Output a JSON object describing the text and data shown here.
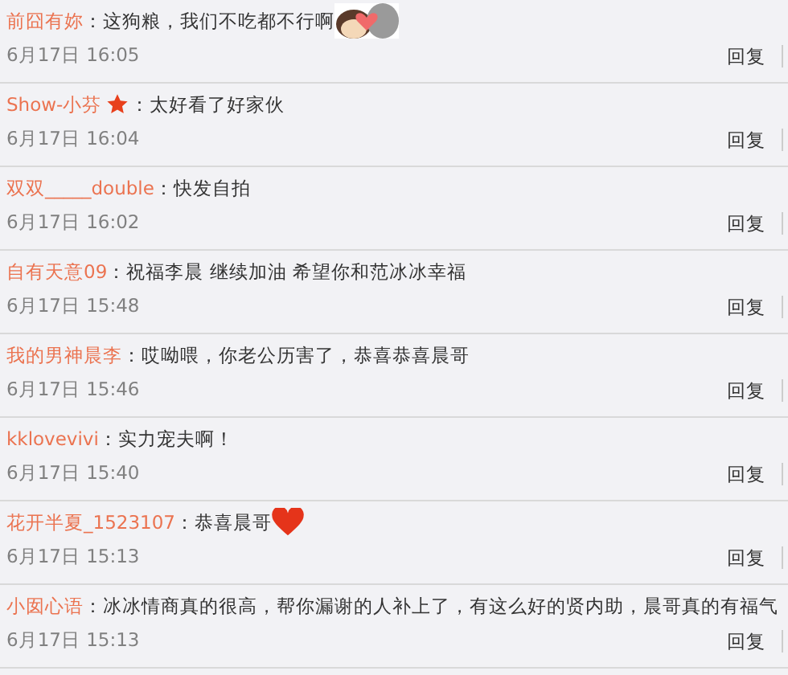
{
  "comments": [
    {
      "kind": "sticker",
      "user": "前囧有妳",
      "text": "：这狗粮，我们不吃都不行啊",
      "time": "6月17日 16:05",
      "reply": "回复"
    },
    {
      "kind": "badged",
      "user": "Show-小芬",
      "text": "：太好看了好家伙",
      "time": "6月17日 16:04",
      "reply": "回复"
    },
    {
      "kind": "plain",
      "user": "双双_____double",
      "text": "：快发自拍",
      "time": "6月17日 16:02",
      "reply": "回复"
    },
    {
      "kind": "plain",
      "user": "自有天意09",
      "text": "：祝福李晨 继续加油 希望你和范冰冰幸福",
      "time": "6月17日 15:48",
      "reply": "回复"
    },
    {
      "kind": "plain",
      "user": "我的男神晨李",
      "text": "：哎呦喂，你老公历害了，恭喜恭喜晨哥",
      "time": "6月17日 15:46",
      "reply": "回复"
    },
    {
      "kind": "plain",
      "user": "kklovevivi",
      "text": "：实力宠夫啊！",
      "time": "6月17日 15:40",
      "reply": "回复"
    },
    {
      "kind": "heart",
      "user": "花开半夏_1523107",
      "text": "：恭喜晨哥",
      "time": "6月17日 15:13",
      "reply": "回复"
    },
    {
      "kind": "plain",
      "user": "小囡心语",
      "text": "：冰冰情商真的很高，帮你漏谢的人补上了，有这么好的贤内助，晨哥真的有福气",
      "time": "6月17日 15:13",
      "reply": "回复"
    }
  ]
}
